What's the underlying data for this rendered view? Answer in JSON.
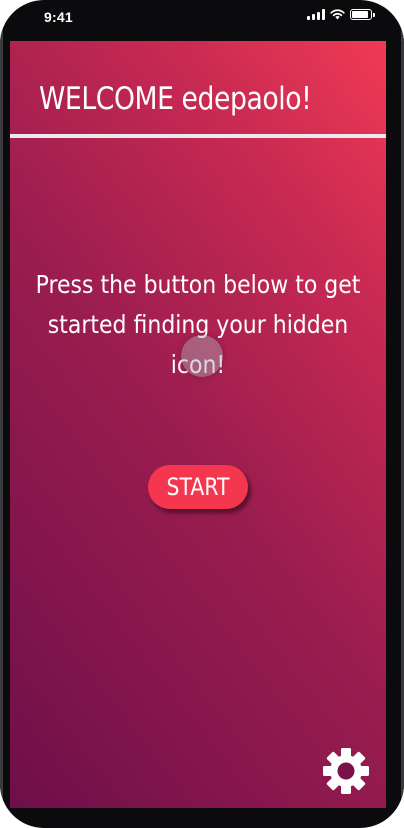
{
  "status_bar": {
    "time": "9:41"
  },
  "header": {
    "title": "WELCOME edepaolo!"
  },
  "main": {
    "instructions": "Press the button below to get started finding your hidden icon!",
    "start_label": "START"
  },
  "icons": {
    "settings": "gear-icon",
    "signal": "cellular-signal-icon",
    "wifi": "wifi-icon",
    "battery": "battery-icon"
  },
  "colors": {
    "gradient_top_right": "#f03a55",
    "gradient_bottom_left": "#6e0f4a",
    "start_button": "#f5364f",
    "divider": "#e9e9ee"
  }
}
